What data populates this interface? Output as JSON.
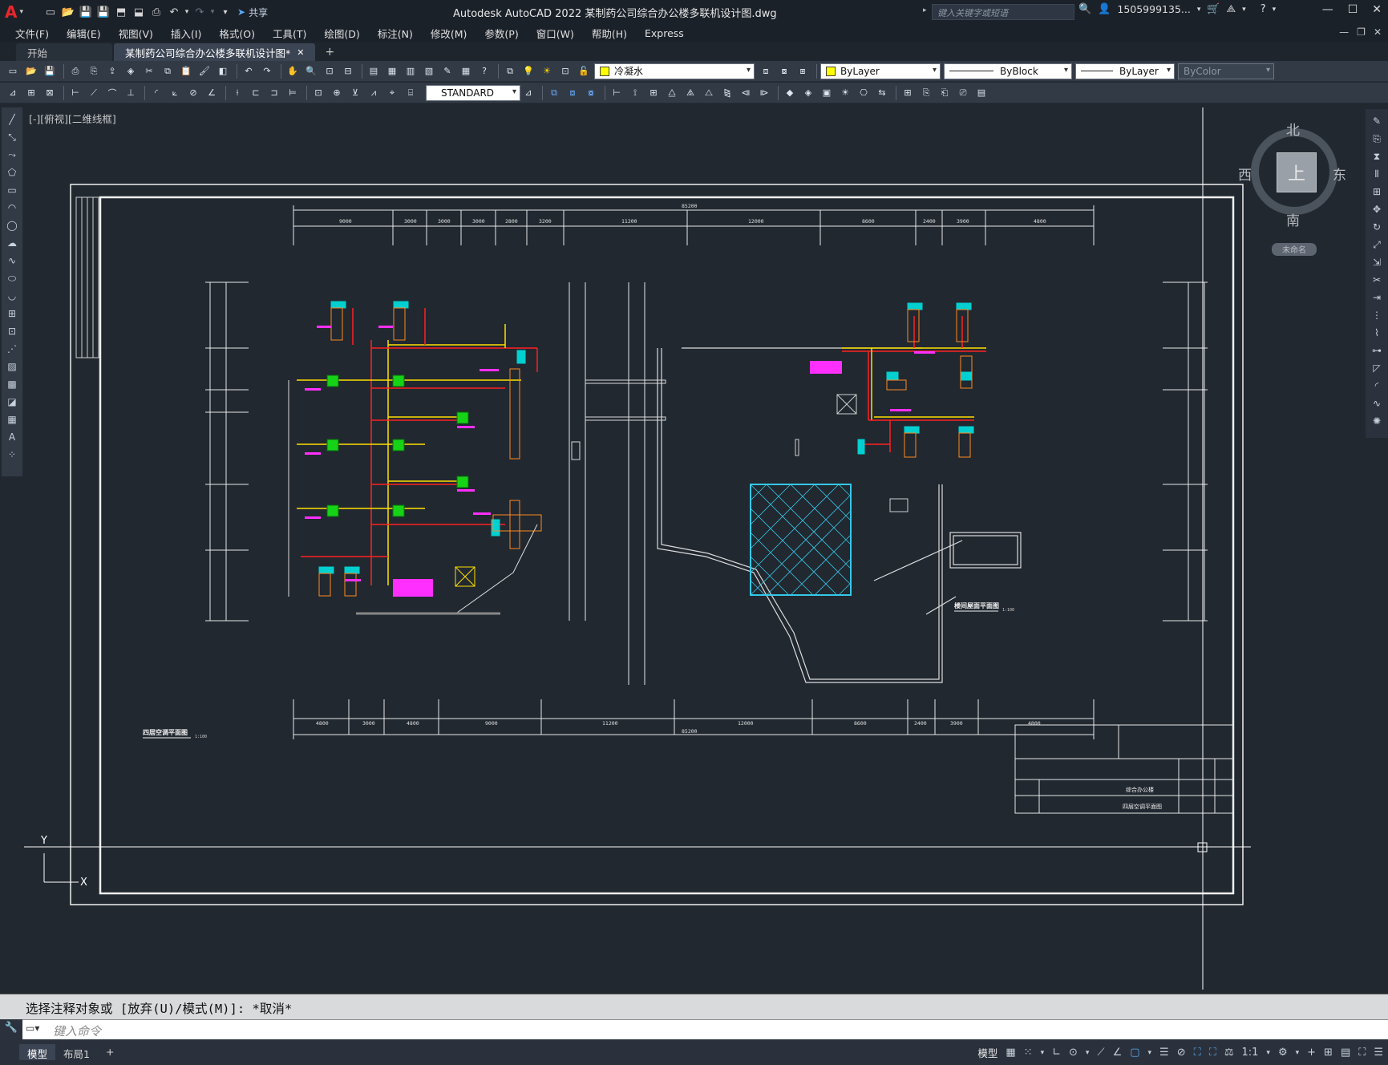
{
  "app": {
    "title": "Autodesk AutoCAD 2022    某制药公司综合办公楼多联机设计图.dwg",
    "search_placeholder": "键入关键字或短语",
    "user": "1505999135...",
    "share_label": "共享"
  },
  "menu": [
    "文件(F)",
    "编辑(E)",
    "视图(V)",
    "插入(I)",
    "格式(O)",
    "工具(T)",
    "绘图(D)",
    "标注(N)",
    "修改(M)",
    "参数(P)",
    "窗口(W)",
    "帮助(H)",
    "Express"
  ],
  "tabs": [
    {
      "label": "开始",
      "active": false
    },
    {
      "label": "某制药公司综合办公楼多联机设计图*",
      "active": true
    }
  ],
  "properties": {
    "layer": "冷凝水",
    "color": "ByLayer",
    "linetype": "ByBlock",
    "lineweight": "ByLayer",
    "plotstyle": "ByColor",
    "text_style": "STANDARD"
  },
  "viewport_label": "[-][俯视][二维线框]",
  "viewcube": {
    "north": "北",
    "south": "南",
    "east": "东",
    "west": "西",
    "face": "上",
    "wcs": "未命名"
  },
  "drawing": {
    "top_dims": [
      "9000",
      "3000",
      "3000",
      "3000",
      "2800",
      "3200",
      "11200",
      "12000",
      "8600",
      "2400",
      "3900",
      "4800"
    ],
    "top_total": "85200",
    "bottom_dims": [
      "4800",
      "3000",
      "4800",
      "9000",
      "11200",
      "12000",
      "8600",
      "2400",
      "3900",
      "4800"
    ],
    "bottom_total": "85200",
    "left_plan_title": "四层空调平面图",
    "left_plan_scale": "1:100",
    "sub_plan_title": "楼间屋面平面图",
    "sub_plan_scale": "1:100",
    "title_block_project": "综合办公楼",
    "title_block_drawing": "四层空调平面图"
  },
  "command": {
    "history": "选择注释对象或 [放弃(U)/模式(M)]: *取消*",
    "input_placeholder": "键入命令"
  },
  "status": {
    "layout_tabs": [
      "模型",
      "布局1"
    ],
    "model_label": "模型",
    "scale": "1:1"
  }
}
